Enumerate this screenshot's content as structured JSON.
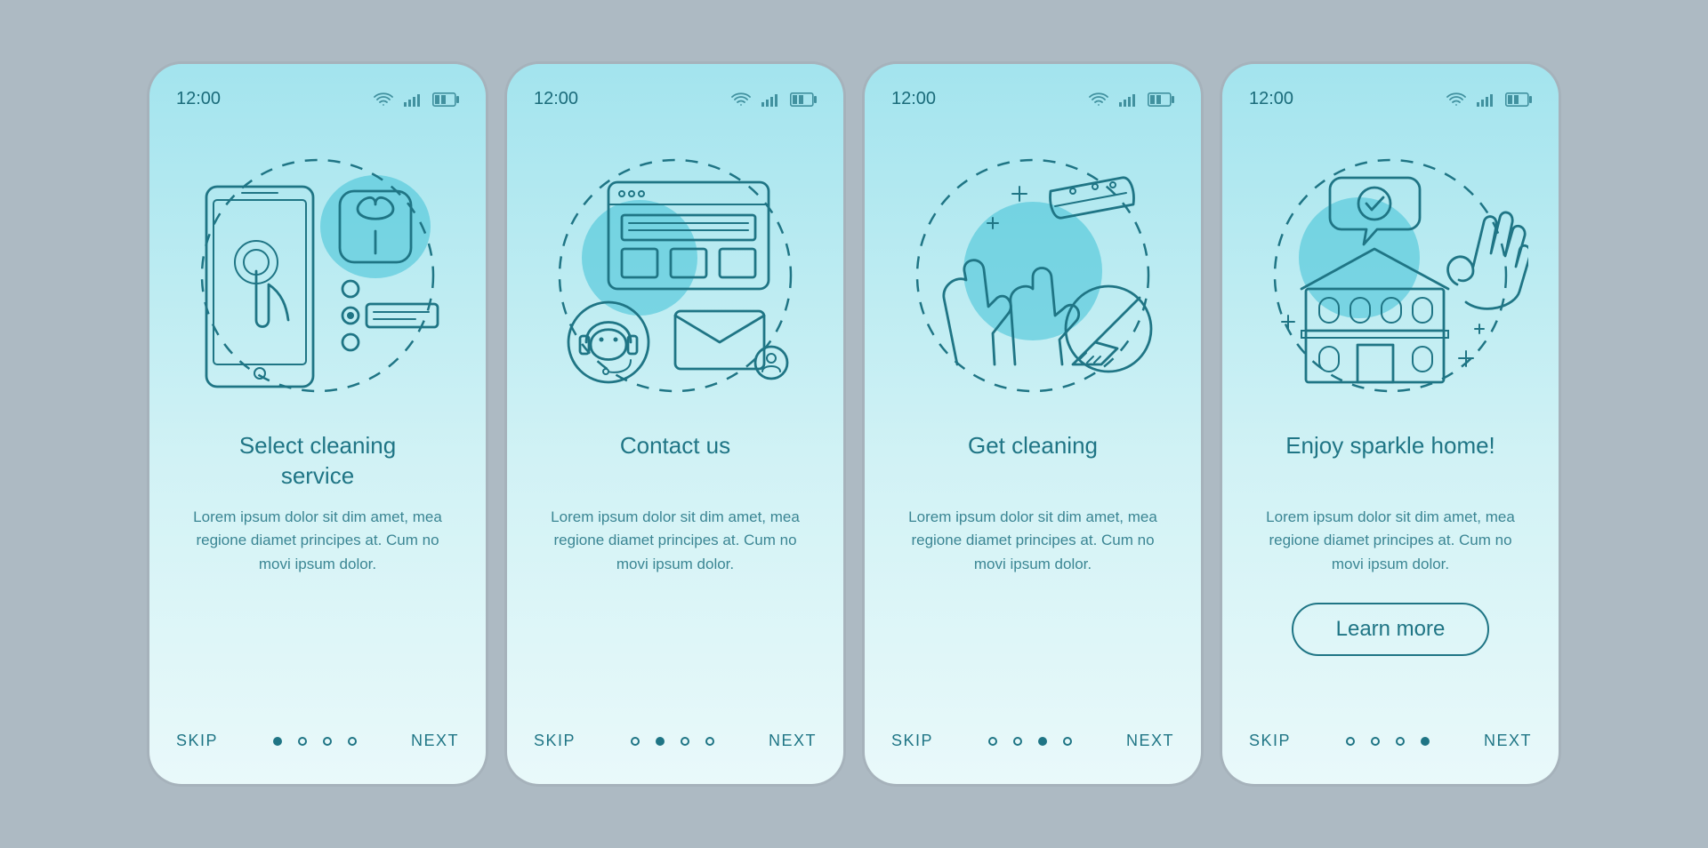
{
  "status_time": "12:00",
  "body_text": "Lorem ipsum dolor sit dim amet, mea regione diamet principes at. Cum no movi ipsum dolor.",
  "nav": {
    "skip": "SKIP",
    "next": "NEXT"
  },
  "screens": [
    {
      "title": "Select cleaning\nservice",
      "illustration": "select-service",
      "active_dot": 0,
      "has_cta": false
    },
    {
      "title": "Contact us",
      "illustration": "contact-us",
      "active_dot": 1,
      "has_cta": false
    },
    {
      "title": "Get cleaning",
      "illustration": "get-cleaning",
      "active_dot": 2,
      "has_cta": false
    },
    {
      "title": "Enjoy sparkle home!",
      "illustration": "enjoy-home",
      "active_dot": 3,
      "has_cta": true,
      "cta_label": "Learn more"
    }
  ],
  "icon_names": {
    "wifi": "wifi-icon",
    "signal": "signal-icon",
    "battery": "battery-icon"
  }
}
